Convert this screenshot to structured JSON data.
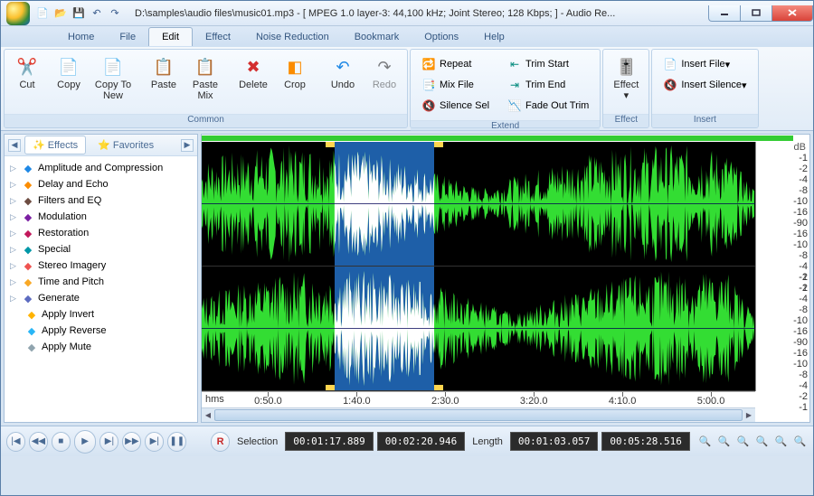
{
  "title": "D:\\samples\\audio files\\music01.mp3 - [ MPEG 1.0 layer-3: 44,100 kHz; Joint Stereo; 128 Kbps;  ] - Audio Re...",
  "menutabs": [
    "Home",
    "File",
    "Edit",
    "Effect",
    "Noise Reduction",
    "Bookmark",
    "Options",
    "Help"
  ],
  "menutab_active": 2,
  "ribbon": {
    "common": {
      "label": "Common",
      "cut": "Cut",
      "copy": "Copy",
      "copy_to_new": "Copy\nTo New",
      "paste": "Paste",
      "paste_mix": "Paste\nMix",
      "delete": "Delete",
      "crop": "Crop",
      "undo": "Undo",
      "redo": "Redo"
    },
    "extend": {
      "label": "Extend",
      "repeat": "Repeat",
      "mix_file": "Mix File",
      "silence_sel": "Silence Sel",
      "trim_start": "Trim Start",
      "trim_end": "Trim End",
      "fade_out_trim": "Fade Out Trim"
    },
    "effect": {
      "label": "Effect",
      "btn": "Effect"
    },
    "insert": {
      "label": "Insert",
      "file": "Insert File",
      "silence": "Insert Silence"
    }
  },
  "sidebar": {
    "tab_effects": "Effects",
    "tab_favorites": "Favorites",
    "items": [
      {
        "label": "Amplitude and Compression",
        "leaf": false,
        "color": "#1e88e5"
      },
      {
        "label": "Delay and Echo",
        "leaf": false,
        "color": "#fb8c00"
      },
      {
        "label": "Filters and EQ",
        "leaf": false,
        "color": "#6d4c41"
      },
      {
        "label": "Modulation",
        "leaf": false,
        "color": "#7b1fa2"
      },
      {
        "label": "Restoration",
        "leaf": false,
        "color": "#c2185b"
      },
      {
        "label": "Special",
        "leaf": false,
        "color": "#0097a7"
      },
      {
        "label": "Stereo Imagery",
        "leaf": false,
        "color": "#ef5350"
      },
      {
        "label": "Time and Pitch",
        "leaf": false,
        "color": "#f9a825"
      },
      {
        "label": "Generate",
        "leaf": false,
        "color": "#5c6bc0"
      },
      {
        "label": "Apply Invert",
        "leaf": true,
        "color": "#ffb300"
      },
      {
        "label": "Apply Reverse",
        "leaf": true,
        "color": "#29b6f6"
      },
      {
        "label": "Apply Mute",
        "leaf": true,
        "color": "#90a4ae"
      }
    ]
  },
  "db_labels": [
    "-1",
    "-2",
    "-4",
    "-8",
    "-10",
    "-16",
    "-90",
    "-16",
    "-10",
    "-8",
    "-4",
    "-2",
    "-1"
  ],
  "time_ticks": [
    {
      "pos": 12,
      "label": "0:50.0"
    },
    {
      "pos": 28,
      "label": "1:40.0"
    },
    {
      "pos": 44,
      "label": "2:30.0"
    },
    {
      "pos": 60,
      "label": "3:20.0"
    },
    {
      "pos": 76,
      "label": "4:10.0"
    },
    {
      "pos": 92,
      "label": "5:00.0"
    }
  ],
  "time_hms": "hms",
  "selection": {
    "start_pct": 24,
    "end_pct": 42
  },
  "status": {
    "sel_label": "Selection",
    "len_label": "Length",
    "sel_start": "00:01:17.889",
    "sel_end": "00:02:20.946",
    "len_val": "00:01:03.057",
    "total": "00:05:28.516",
    "rec": "R"
  }
}
